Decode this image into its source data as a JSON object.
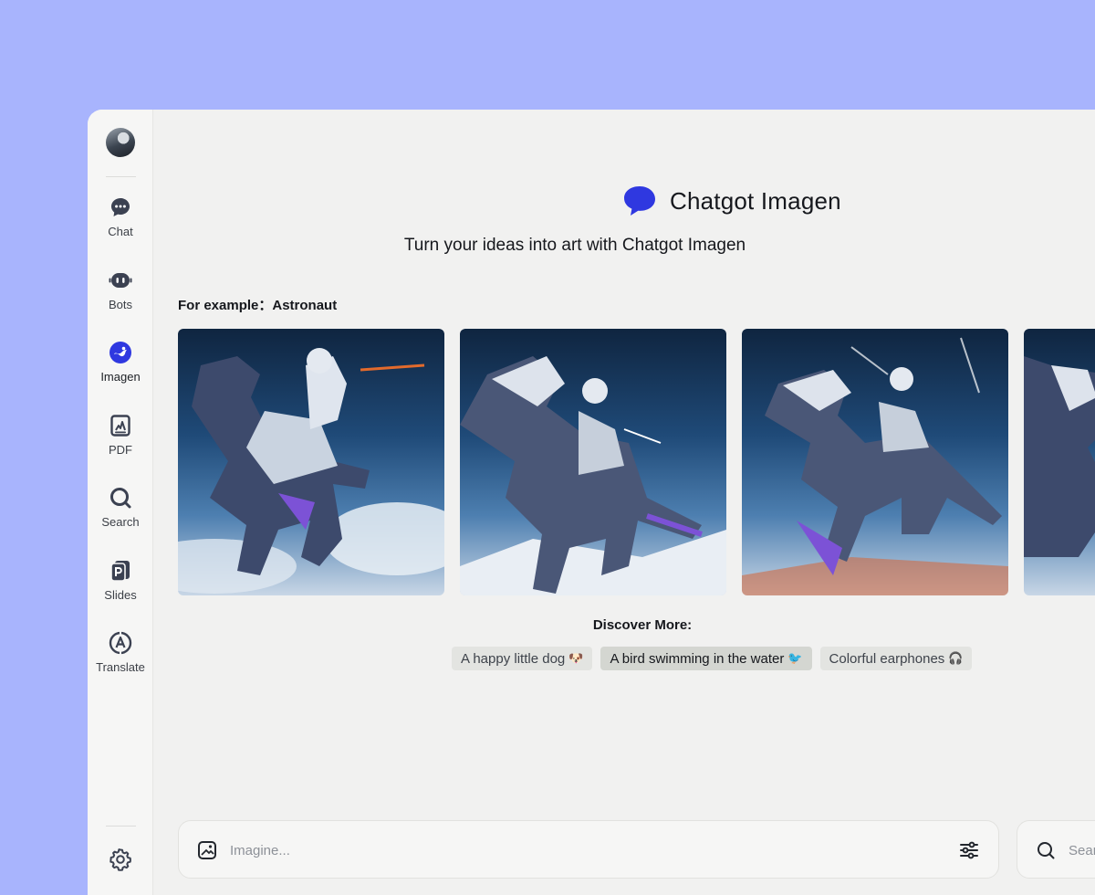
{
  "sidebar": {
    "items": [
      {
        "label": "Chat",
        "icon": "chat-bubble-icon"
      },
      {
        "label": "Bots",
        "icon": "bot-icon"
      },
      {
        "label": "Imagen",
        "icon": "imagen-icon",
        "active": true
      },
      {
        "label": "PDF",
        "icon": "pdf-icon"
      },
      {
        "label": "Search",
        "icon": "search-icon"
      },
      {
        "label": "Slides",
        "icon": "slides-icon"
      },
      {
        "label": "Translate",
        "icon": "translate-icon"
      }
    ],
    "accent": "#2f38e0"
  },
  "header": {
    "app_name": "Chatgot Imagen",
    "subtitle": "Turn your ideas into art with Chatgot Imagen"
  },
  "examples": {
    "label": "For example：",
    "topic": "Astronaut",
    "images": [
      "robot-dinosaur-astronaut-1",
      "robot-dinosaur-astronaut-2",
      "robot-dinosaur-astronaut-3",
      "robot-dinosaur-astronaut-4"
    ]
  },
  "discover": {
    "title": "Discover More:",
    "chips": [
      {
        "label": "A happy little dog",
        "emoji": "🐶"
      },
      {
        "label": "A bird swimming in the water",
        "emoji": "🐦"
      },
      {
        "label": "Colorful earphones",
        "emoji": "🎧"
      }
    ]
  },
  "prompt": {
    "placeholder": "Imagine..."
  },
  "search": {
    "placeholder": "Search"
  }
}
